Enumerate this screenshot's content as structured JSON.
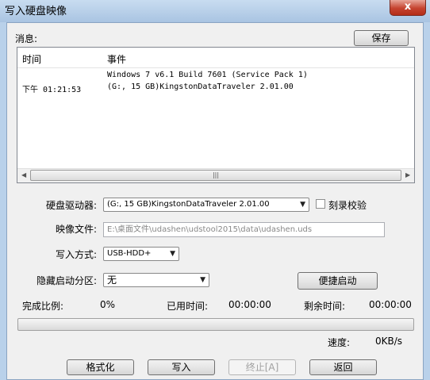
{
  "window": {
    "title": "写入硬盘映像",
    "close_glyph": "x"
  },
  "log": {
    "label": "消息:",
    "save_label": "保存",
    "columns": [
      "时间",
      "事件"
    ],
    "rows": [
      {
        "time": "",
        "event": "Windows 7 v6.1 Build 7601 (Service Pack 1)"
      },
      {
        "time": "下午 01:21:53",
        "event": "(G:, 15 GB)KingstonDataTraveler 2.01.00"
      }
    ]
  },
  "form": {
    "drive_label": "硬盘驱动器:",
    "drive_value": "(G:, 15 GB)KingstonDataTraveler 2.01.00",
    "verify_label": "刻录校验",
    "verify_checked": false,
    "image_label": "映像文件:",
    "image_value": "E:\\桌面文件\\udashen\\udstool2015\\data\\udashen.uds",
    "write_method_label": "写入方式:",
    "write_method_value": "USB-HDD+",
    "hidden_partition_label": "隐藏启动分区:",
    "hidden_partition_value": "无",
    "quick_boot_label": "便捷启动"
  },
  "status": {
    "percent_label": "完成比例:",
    "percent_value": "0%",
    "elapsed_label": "已用时间:",
    "elapsed_value": "00:00:00",
    "remaining_label": "剩余时间:",
    "remaining_value": "00:00:00",
    "progress_fraction": 0,
    "speed_label": "速度:",
    "speed_value": "0KB/s"
  },
  "buttons": {
    "format": "格式化",
    "write": "写入",
    "abort": "终止[A]",
    "back": "返回"
  }
}
